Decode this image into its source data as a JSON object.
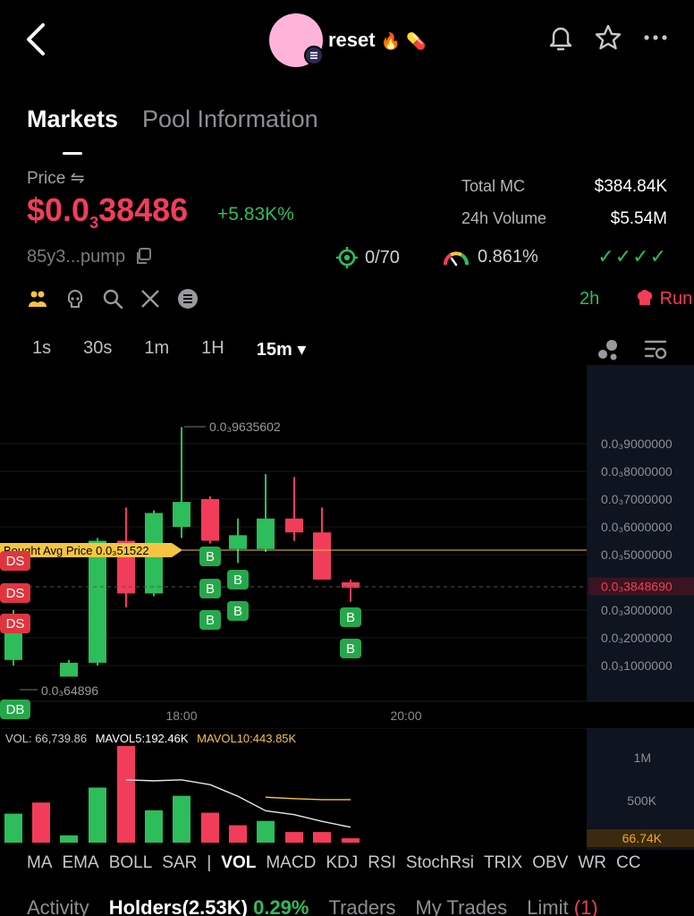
{
  "header": {
    "token_name": "reset",
    "fire_emoji": "🔥",
    "pill_emoji": "💊"
  },
  "tabs": [
    "Markets",
    "Pool Information"
  ],
  "price": {
    "label": "Price ⇋",
    "prefix": "$0.0",
    "zeros": "3",
    "digits": "38486",
    "change": "+5.83K%"
  },
  "address": "85y3...pump",
  "stats": [
    {
      "label": "Total MC",
      "value": "$384.84K"
    },
    {
      "label": "24h Volume",
      "value": "$5.54M"
    }
  ],
  "metrics": {
    "holders_ratio": "0/70",
    "gauge": "0.861%",
    "checks": "✓✓✓✓"
  },
  "age": "2h",
  "run_label": "Run",
  "intervals": [
    "1s",
    "30s",
    "1m",
    "1H",
    "15m ▾"
  ],
  "chart": {
    "y_labels": [
      "0.0₃9000000",
      "0.0₃8000000",
      "0.0₃7000000",
      "0.0₃6000000",
      "0.0₃5000000",
      "0.0₃3848690",
      "0.0₃3000000",
      "0.0₃2000000",
      "0.0₃1000000"
    ],
    "x_labels": [
      "18:00",
      "20:00"
    ],
    "high_label": "0.0₃9635602",
    "low_label": "0.0₃64896",
    "avg_label": "Bought Avg Price 0.0₃51522",
    "trade_tags": {
      "ds": "DS",
      "db": "DB",
      "b": "B"
    },
    "vol_labels": [
      "1M",
      "500K",
      "66.74K"
    ],
    "vol_legend": {
      "vol": "VOL: 66,739.86",
      "mavol5": "MAVOL5:192.46K",
      "mavol10": "MAVOL10:443.85K"
    }
  },
  "chart_data": {
    "type": "candlestick",
    "unit": "0.0₃ prefix (×1e-4)",
    "x_ticks": [
      "18:00",
      "20:00"
    ],
    "current_price": 0.384869,
    "bought_avg": 0.51522,
    "high": 0.9635602,
    "low": 0.064896,
    "candles": [
      {
        "o": 0.12,
        "c": 0.27,
        "h": 0.3,
        "l": 0.1
      },
      {
        "o": 0.06,
        "c": 0.11,
        "h": 0.12,
        "l": 0.06
      },
      {
        "o": 0.11,
        "c": 0.55,
        "h": 0.56,
        "l": 0.1
      },
      {
        "o": 0.55,
        "c": 0.36,
        "h": 0.67,
        "l": 0.31
      },
      {
        "o": 0.36,
        "c": 0.65,
        "h": 0.66,
        "l": 0.35
      },
      {
        "o": 0.6,
        "c": 0.69,
        "h": 0.96,
        "l": 0.56
      },
      {
        "o": 0.7,
        "c": 0.55,
        "h": 0.71,
        "l": 0.54
      },
      {
        "o": 0.52,
        "c": 0.57,
        "h": 0.63,
        "l": 0.47
      },
      {
        "o": 0.52,
        "c": 0.63,
        "h": 0.79,
        "l": 0.51
      },
      {
        "o": 0.63,
        "c": 0.58,
        "h": 0.78,
        "l": 0.55
      },
      {
        "o": 0.58,
        "c": 0.41,
        "h": 0.67,
        "l": 0.41
      },
      {
        "o": 0.4,
        "c": 0.38,
        "h": 0.41,
        "l": 0.33
      }
    ],
    "volume": [
      300,
      415,
      75,
      570,
      1000,
      335,
      485,
      310,
      180,
      225,
      110,
      110,
      45
    ],
    "volume_unit": "K"
  },
  "indicators": [
    "MA",
    "EMA",
    "BOLL",
    "SAR",
    "|",
    "VOL",
    "MACD",
    "KDJ",
    "RSI",
    "StochRsi",
    "TRIX",
    "OBV",
    "WR",
    "CC"
  ],
  "bottom_tabs": {
    "activity": "Activity",
    "holders": "Holders(2.53K)",
    "holders_pct": "0.29%",
    "traders": "Traders",
    "my_trades": "My Trades",
    "limit": "Limit",
    "limit_count": "(1)"
  },
  "colors": {
    "green": "#2dbd5b",
    "red": "#f23d5a",
    "yellow": "#f5c542",
    "background": "#000000"
  }
}
